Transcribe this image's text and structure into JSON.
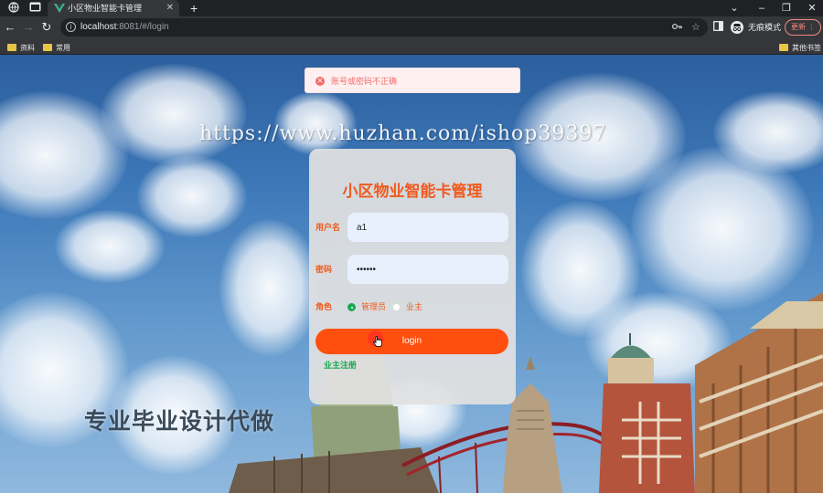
{
  "browser": {
    "tab_title": "小区物业智能卡管理",
    "url_host": "localhost",
    "url_rest": ":8081/#/login",
    "incognito_label": "无痕模式",
    "update_label": "更新"
  },
  "bookmarks": {
    "items": [
      "资料",
      "常用"
    ],
    "other": "其他书签"
  },
  "page": {
    "watermark": "https://www.huzhan.com/ishop39397",
    "promo_text": "专业毕业设计代做"
  },
  "toast": {
    "message": "账号或密码不正确"
  },
  "login": {
    "title": "小区物业智能卡管理",
    "username_label": "用户名",
    "username_value": "a1",
    "password_label": "密码",
    "password_value": "••••••",
    "role_label": "角色",
    "roles": [
      "管理员",
      "业主"
    ],
    "selected_role": "管理员",
    "login_button": "login",
    "register_link": "业主注册"
  },
  "colors": {
    "accent": "#ff4f0f",
    "title": "#f05a1e",
    "success": "#1aaa55",
    "error": "#f56c6c"
  }
}
